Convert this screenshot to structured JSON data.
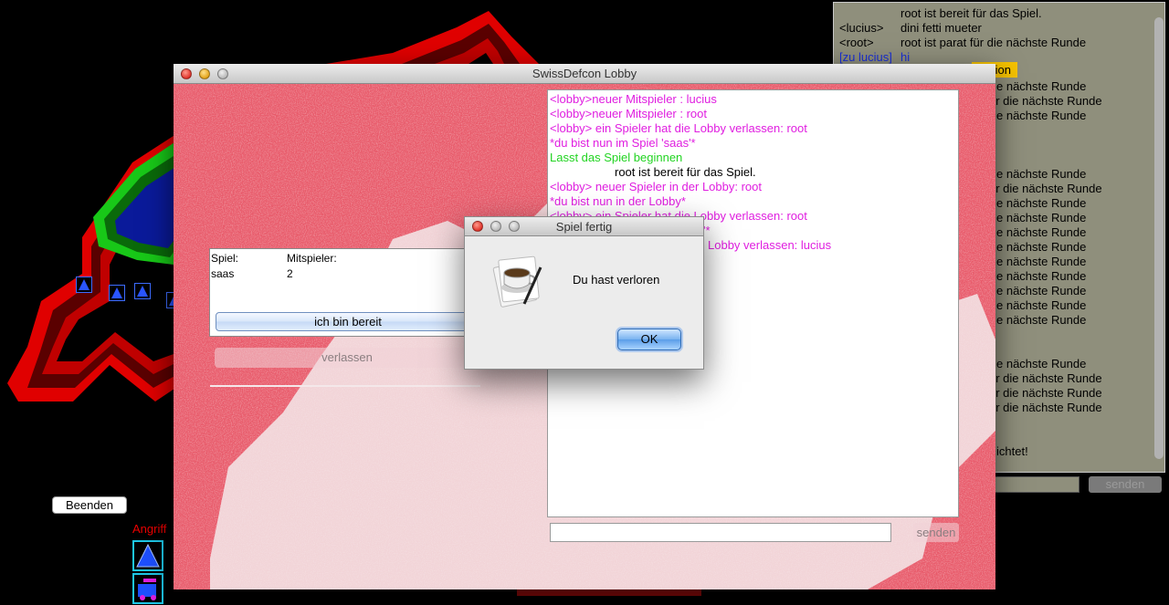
{
  "background": {
    "quit_button": "Beenden",
    "attack_label": "Angriff",
    "chat": {
      "lines": [
        {
          "tag": "",
          "text": "root ist bereit für das Spiel."
        },
        {
          "tag": "<lucius>",
          "text": "dini fetti mueter"
        },
        {
          "tag": "<root>",
          "text": "root ist parat für die nächste Runde"
        },
        {
          "tag": "[zu lucius]",
          "text": "hi"
        }
      ],
      "highlight": "tion",
      "fragments": [
        "e nächste Runde",
        "ür die nächste Runde",
        "e nächste Runde",
        "e nächste Runde",
        "ür die nächste Runde",
        "e nächste Runde",
        "e nächste Runde",
        "e nächste Runde",
        "e nächste Runde",
        "e nächste Runde",
        "e nächste Runde",
        "e nächste Runde",
        "e nächste Runde",
        "e nächste Runde",
        "e nächste Runde",
        "ür die nächste Runde",
        "ür die nächste Runde",
        "ür die nächste Runde",
        "ichtet!"
      ],
      "send_label": "senden"
    }
  },
  "lobby": {
    "title": "SwissDefcon Lobby",
    "games_table": {
      "headers": [
        "Spiel:",
        "Mitspieler:"
      ],
      "rows": [
        [
          "saas",
          "2"
        ]
      ]
    },
    "ready_button": "ich bin bereit",
    "leave_button": "verlassen",
    "chat_lines": [
      {
        "style": "sys",
        "text": "<lobby>neuer Mitspieler : lucius"
      },
      {
        "style": "sys",
        "text": "<lobby>neuer Mitspieler : root"
      },
      {
        "style": "sys",
        "text": "<lobby> ein Spieler hat die Lobby verlassen: root"
      },
      {
        "style": "sys",
        "text": " *du bist nun im Spiel 'saas'*"
      },
      {
        "style": "green",
        "text": "Lasst das Spiel beginnen"
      },
      {
        "style": "black",
        "text": "root ist bereit für das Spiel."
      },
      {
        "style": "sys",
        "text": "<lobby> neuer Spieler in der Lobby: root"
      },
      {
        "style": "sys",
        "text": " *du bist nun in der Lobby*"
      },
      {
        "style": "sys",
        "text": "<lobby> ein Spieler hat die Lobby verlassen: root"
      },
      {
        "style": "sys",
        "text": "'*"
      },
      {
        "style": "sys",
        "text": "Lobby verlassen: lucius"
      }
    ],
    "send_button": "senden"
  },
  "dialog": {
    "title": "Spiel fertig",
    "message": "Du hast verloren",
    "ok_button": "OK"
  },
  "colors": {
    "lobby_background": "#e85a6a",
    "system_message": "#e01ee0",
    "game_start_message": "#22d422",
    "whisper": "#1a2fd6",
    "map_border": "#e00000",
    "player_territory": "#0a1a9a",
    "player_border": "#18c818"
  }
}
